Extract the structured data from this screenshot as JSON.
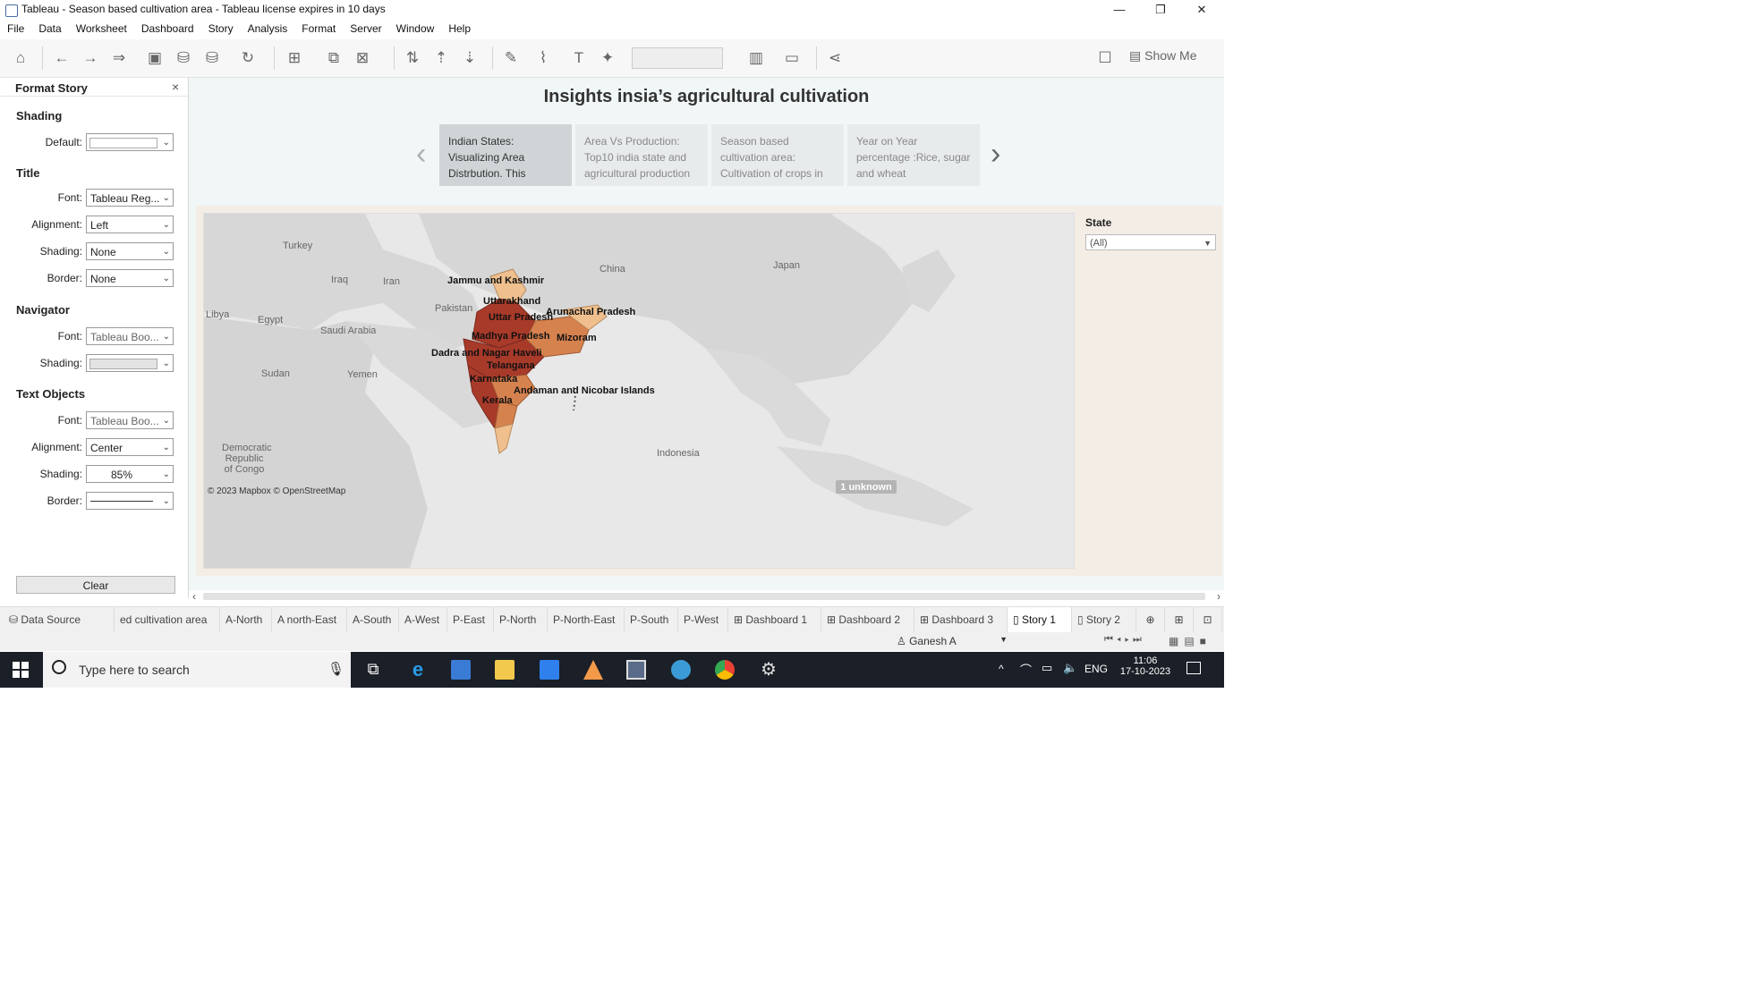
{
  "window": {
    "title": "Tableau - Season based cultivation area - Tableau license expires in 10 days",
    "min": "—",
    "max": "❐",
    "close": "✕"
  },
  "menu": [
    "File",
    "Data",
    "Worksheet",
    "Dashboard",
    "Story",
    "Analysis",
    "Format",
    "Server",
    "Window",
    "Help"
  ],
  "toolbar": {
    "show_me": "Show Me"
  },
  "format_panel": {
    "title": "Format Story",
    "close": "×",
    "shading_title": "Shading",
    "default_label": "Default:",
    "title_section": "Title",
    "title_font_label": "Font:",
    "title_font": "Tableau Reg...",
    "title_alignment_label": "Alignment:",
    "title_alignment": "Left",
    "title_shading_label": "Shading:",
    "title_shading": "None",
    "title_border_label": "Border:",
    "title_border": "None",
    "navigator_section": "Navigator",
    "nav_font_label": "Font:",
    "nav_font": "Tableau Boo...",
    "nav_shading_label": "Shading:",
    "text_section": "Text Objects",
    "text_font_label": "Font:",
    "text_font": "Tableau Boo...",
    "text_alignment_label": "Alignment:",
    "text_alignment": "Center",
    "text_shading_label": "Shading:",
    "text_shading": "85%",
    "text_border_label": "Border:",
    "clear": "Clear"
  },
  "story": {
    "title": "Insights insia’s agricultural cultivation",
    "points": [
      "Indian States: Visualizing Area Distrbution. This",
      "Area Vs Production: Top10 india state and agricultural production",
      "Season based cultivation area: Cultivation of crops in",
      "Year on Year percentage :Rice, sugar and wheat"
    ]
  },
  "map": {
    "credits": "© 2023 Mapbox © OpenStreetMap",
    "unknown_badge": "1 unknown",
    "country_labels": [
      "Turkey",
      "Iraq",
      "Iran",
      "China",
      "Japan",
      "Libya",
      "Egypt",
      "Saudi Arabia",
      "Pakistan",
      "Sudan",
      "Yemen",
      "Democratic Republic of Congo",
      "Indonesia"
    ],
    "state_labels": [
      "Jammu and Kashmir",
      "Uttarakhand",
      "Uttar Pradesh",
      "Arunachal Pradesh",
      "Madhya Pradesh",
      "Mizoram",
      "Dadra and Nagar Haveli",
      "Telangana",
      "Karnataka",
      "Andaman and Nicobar Islands",
      "Kerala"
    ],
    "colors": {
      "high": "#a83a2a",
      "mid": "#d6824f",
      "low": "#efc08e",
      "land": "#d5d5d5",
      "water": "#e8e8e8"
    }
  },
  "filter": {
    "title": "State",
    "value": "(All)"
  },
  "tabs": [
    "Data Source",
    "ed cultivation area",
    "A-North",
    "A north-East",
    "A-South",
    "A-West",
    "P-East",
    "P-North",
    "P-North-East",
    "P-South",
    "P-West",
    "Dashboard 1",
    "Dashboard 2",
    "Dashboard 3",
    "Story 1",
    "Story 2"
  ],
  "status": {
    "user": "Ganesh A"
  },
  "taskbar": {
    "search_placeholder": "Type here to search",
    "lang": "ENG",
    "time": "11:06",
    "date": "17-10-2023"
  }
}
